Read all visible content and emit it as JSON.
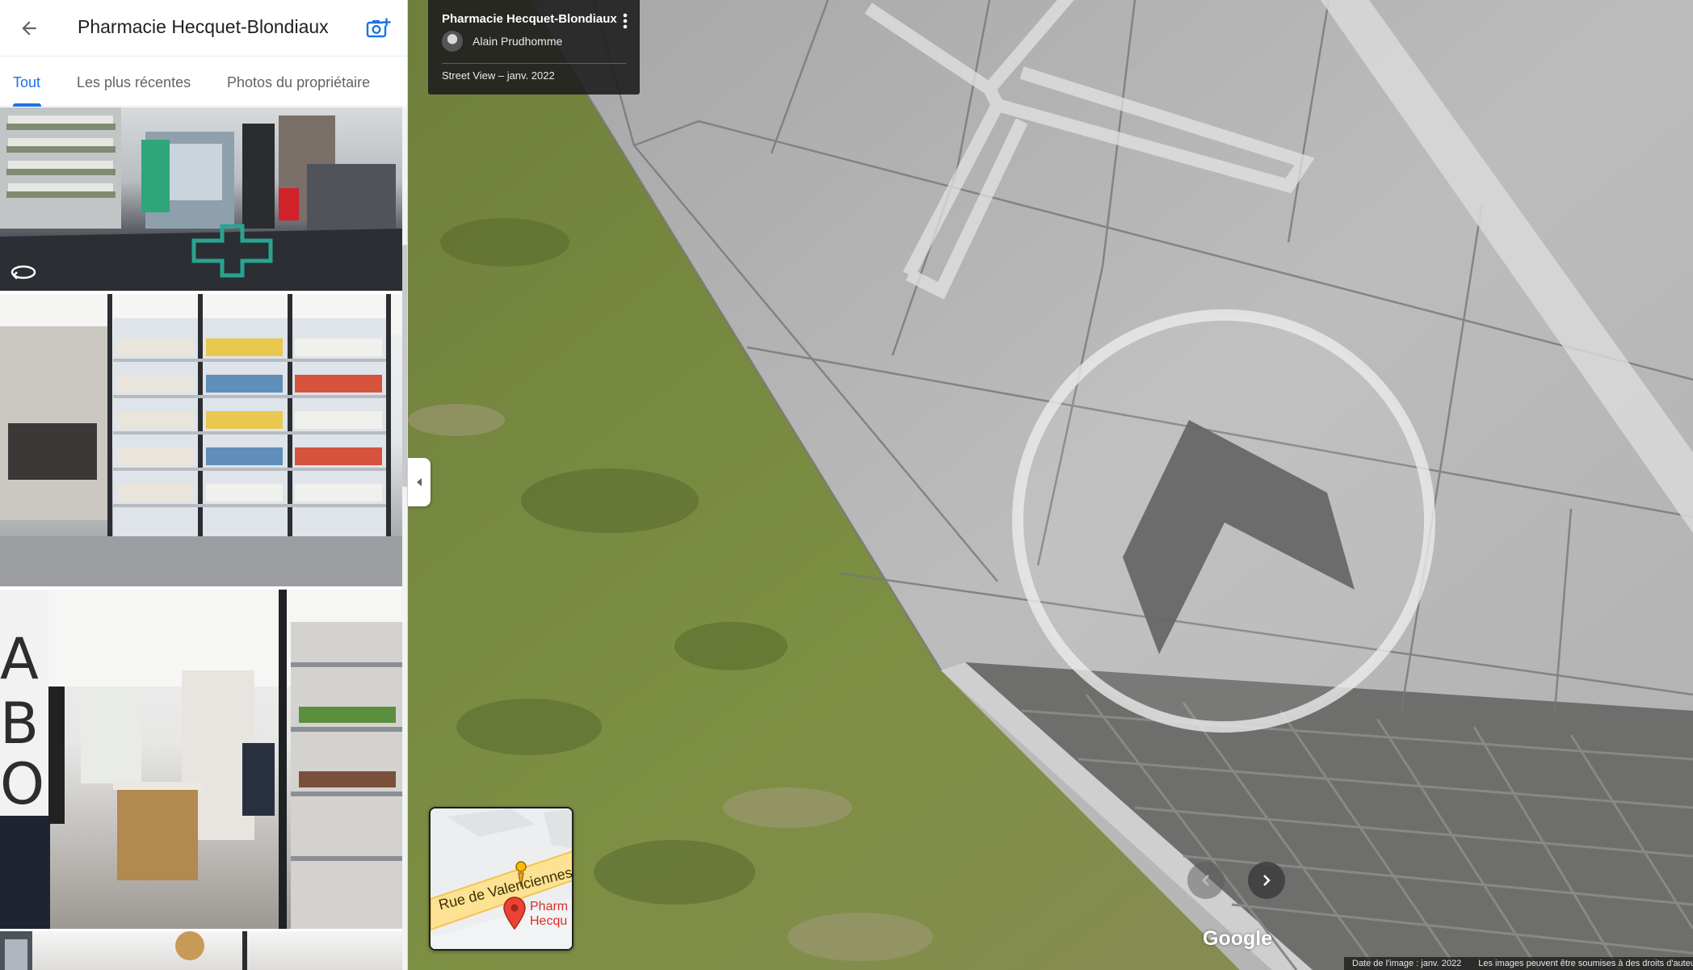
{
  "panel": {
    "title": "Pharmacie Hecquet-Blondiaux",
    "back_icon": "arrow-left-icon",
    "add_photo_icon": "add-photo-camera-icon",
    "tabs": [
      {
        "label": "Tout",
        "active": true
      },
      {
        "label": "Les plus récentes",
        "active": false
      },
      {
        "label": "Photos du propriétaire",
        "active": false
      }
    ],
    "photo_badge_icon": "360-view-icon"
  },
  "streetview": {
    "place_title": "Pharmacie Hecquet-Blondiaux",
    "author": "Alain Prudhomme",
    "capture_date": "Street View – janv. 2022",
    "minimap": {
      "road": "Rue de Valenciennes",
      "place_lines": [
        "Pharm",
        "Hecqu"
      ]
    },
    "brand": "Google",
    "footer": {
      "image_date": "Date de l'image : janv. 2022",
      "rights": "Les images peuvent être soumises à des droits d'auteur."
    }
  },
  "colors": {
    "accent": "#1a73e8",
    "pin": "#ea4335",
    "road_yellow": "#fce8b2"
  }
}
